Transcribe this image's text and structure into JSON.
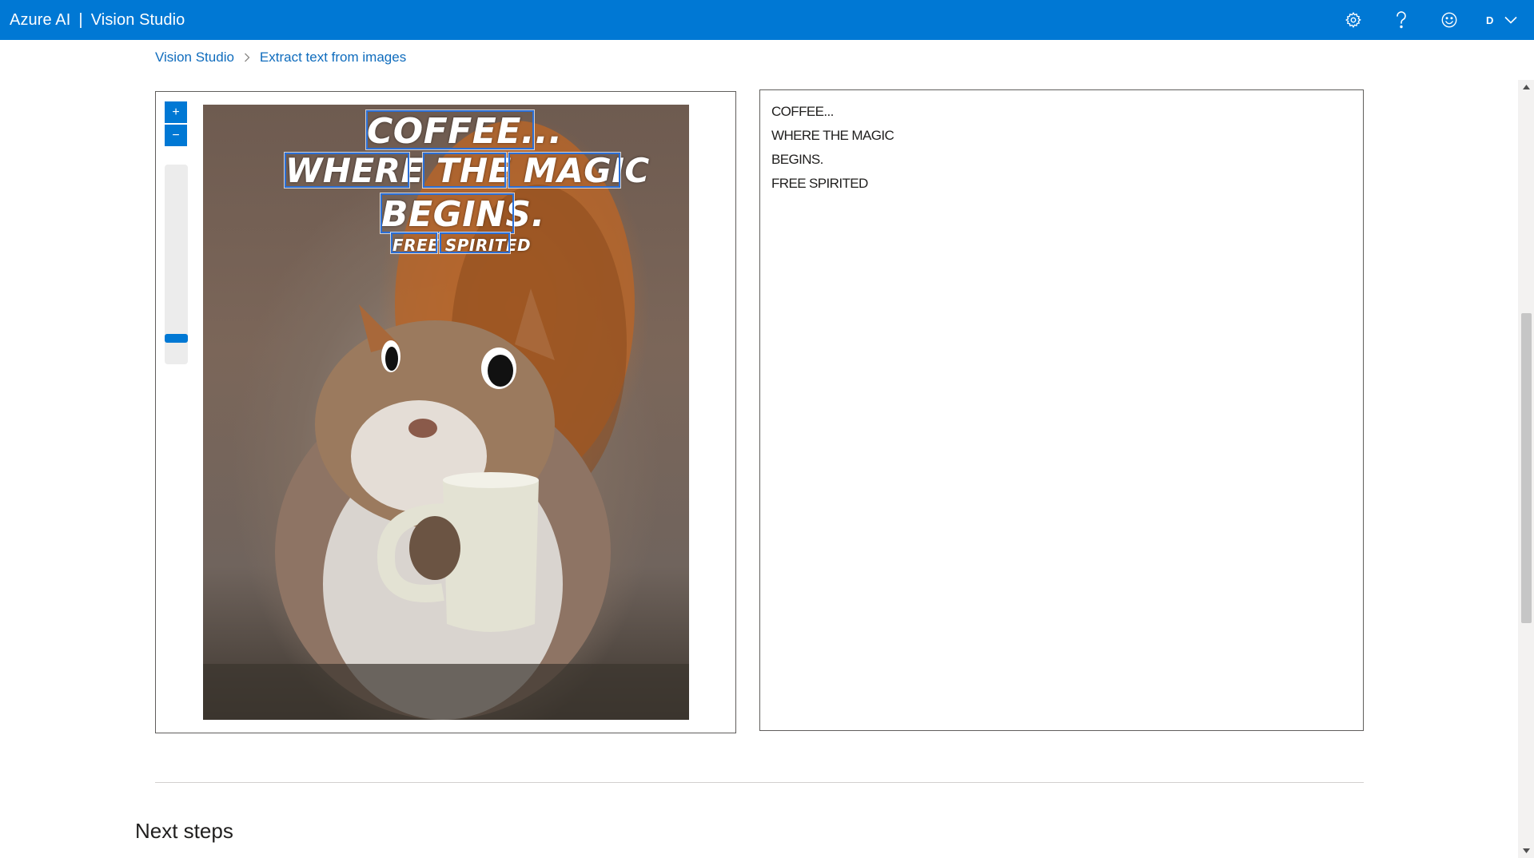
{
  "header": {
    "brand": "Azure AI",
    "separator": "|",
    "app_name": "Vision Studio",
    "avatar_initial": "D"
  },
  "breadcrumb": {
    "home": "Vision Studio",
    "current": "Extract text from images"
  },
  "image_viewer": {
    "zoom_in_label": "+",
    "zoom_out_label": "−",
    "zoom_level_fraction": 0.08,
    "image_text_lines": [
      "COFFEE...",
      "WHERE THE MAGIC",
      "BEGINS.",
      "FREE SPIRITED"
    ],
    "detected_words": [
      "COFFEE...",
      "WHERE",
      "THE",
      "MAGIC",
      "BEGINS.",
      "FREE",
      "SPIRITED"
    ]
  },
  "results": {
    "lines": [
      "COFFEE...",
      "WHERE THE MAGIC",
      "BEGINS.",
      "FREE SPIRITED"
    ]
  },
  "next_steps": {
    "title": "Next steps"
  },
  "colors": {
    "accent": "#0078d4",
    "link": "#0f6cbd",
    "ocr_box": "#2b6fd6"
  },
  "icons": [
    "settings-gear-icon",
    "help-question-icon",
    "feedback-smiley-icon",
    "chevron-down-icon",
    "breadcrumb-chevron-icon"
  ]
}
